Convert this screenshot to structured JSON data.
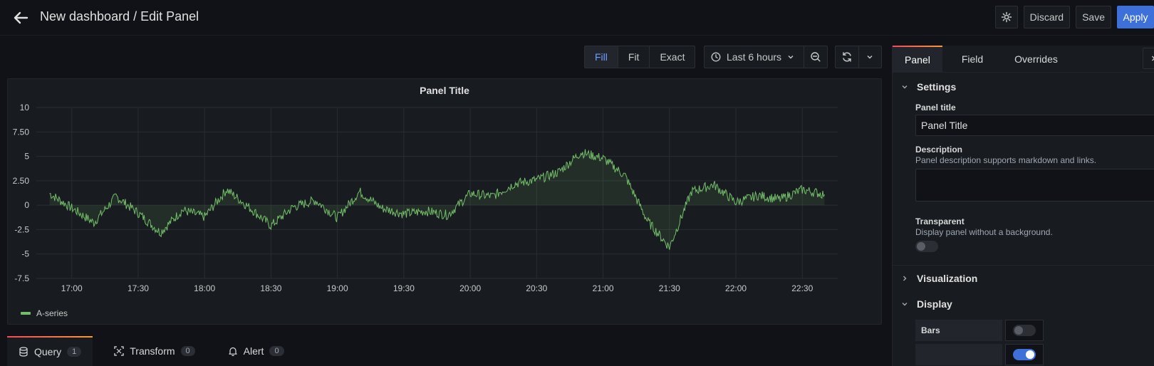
{
  "header": {
    "title": "New dashboard / Edit Panel",
    "discard_label": "Discard",
    "save_label": "Save",
    "apply_label": "Apply"
  },
  "view_modes": [
    {
      "label": "Fill",
      "active": true
    },
    {
      "label": "Fit",
      "active": false
    },
    {
      "label": "Exact",
      "active": false
    }
  ],
  "time_picker": {
    "label": "Last 6 hours"
  },
  "panel": {
    "title": "Panel Title",
    "legend": [
      {
        "name": "A-series",
        "color": "#73bf69"
      }
    ]
  },
  "chart_data": {
    "type": "line",
    "title": "Panel Title",
    "fill": true,
    "grid": true,
    "legend_placement": "bottom-left",
    "ylim": [
      -7.5,
      10
    ],
    "yticks": [
      "10",
      "7.50",
      "5",
      "2.50",
      "0",
      "-2.5",
      "-5",
      "-7.5"
    ],
    "xticks": [
      "17:00",
      "17:30",
      "18:00",
      "18:30",
      "19:00",
      "19:30",
      "20:00",
      "20:30",
      "21:00",
      "21:30",
      "22:00",
      "22:30"
    ],
    "series": [
      {
        "name": "A-series",
        "color": "#73bf69",
        "x": [
          "16:50",
          "17:00",
          "17:10",
          "17:20",
          "17:30",
          "17:40",
          "17:50",
          "18:00",
          "18:10",
          "18:20",
          "18:30",
          "18:40",
          "18:50",
          "19:00",
          "19:10",
          "19:20",
          "19:30",
          "19:40",
          "19:50",
          "20:00",
          "20:10",
          "20:20",
          "20:30",
          "20:40",
          "20:50",
          "21:00",
          "21:10",
          "21:20",
          "21:30",
          "21:40",
          "21:50",
          "22:00",
          "22:10",
          "22:20",
          "22:30",
          "22:40"
        ],
        "values": [
          1.2,
          -0.3,
          -1.8,
          0.9,
          -0.8,
          -2.8,
          -0.5,
          -1.2,
          1.6,
          -0.2,
          -2.1,
          -0.2,
          0.5,
          -1.3,
          1.4,
          -0.3,
          -0.9,
          -0.6,
          -1.0,
          1.2,
          0.9,
          2.2,
          2.6,
          3.4,
          5.4,
          4.8,
          3.0,
          -1.6,
          -4.3,
          1.4,
          2.1,
          0.3,
          1.0,
          0.6,
          1.6,
          1.1
        ]
      }
    ]
  },
  "bottom_tabs": [
    {
      "label": "Query",
      "count": "1",
      "icon": "database-icon",
      "active": true
    },
    {
      "label": "Transform",
      "count": "0",
      "icon": "transform-icon",
      "active": false
    },
    {
      "label": "Alert",
      "count": "0",
      "icon": "bell-icon",
      "active": false
    }
  ],
  "options": {
    "tabs": [
      {
        "label": "Panel",
        "active": true
      },
      {
        "label": "Field",
        "active": false
      },
      {
        "label": "Overrides",
        "active": false
      }
    ],
    "settings_label": "Settings",
    "panel_title_label": "Panel title",
    "panel_title_value": "Panel Title",
    "description_label": "Description",
    "description_help": "Panel description supports markdown and links.",
    "transparent_label": "Transparent",
    "transparent_help": "Display panel without a background.",
    "visualization_label": "Visualization",
    "display_label": "Display",
    "bars_label": "Bars"
  }
}
